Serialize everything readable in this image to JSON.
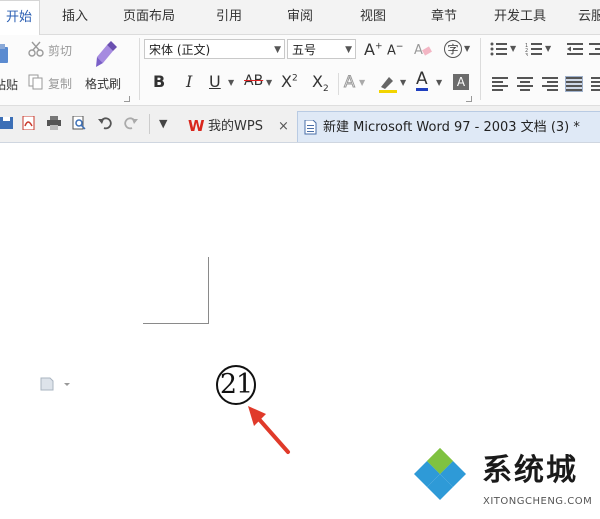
{
  "menu": {
    "tabs": [
      "开始",
      "插入",
      "页面布局",
      "引用",
      "审阅",
      "视图",
      "章节",
      "开发工具",
      "云服"
    ],
    "active_index": 0
  },
  "ribbon": {
    "paste_label": "粘贴",
    "cut_label": "剪切",
    "copy_label": "复制",
    "format_painter_label": "格式刷",
    "font_name": "宋体 (正文)",
    "font_size": "五号",
    "bold": "B",
    "italic": "I",
    "underline": "U",
    "strikethrough": "AB",
    "superscript": "X",
    "superscript_mark": "2",
    "subscript": "X",
    "subscript_mark": "2",
    "grow_font": "A",
    "shrink_font": "A",
    "text_effect": "A",
    "font_color_glyph": "A",
    "enclose_glyph": "字",
    "accent_blue": "#2b5fb3",
    "highlight_color": "#f2d400",
    "font_color": "#1f3fbf"
  },
  "tabs": {
    "wps_tab_label": "我的WPS",
    "wps_tab_close": "×",
    "doc_tab_label": "新建 Microsoft Word 97 - 2003 文档 (3) *",
    "wps_brand_color": "#d9261c"
  },
  "document": {
    "enclosed_number": "21",
    "arrow_color": "#e03a2a"
  },
  "watermark": {
    "brand": "系统城",
    "url": "XITONGCHENG.COM"
  }
}
